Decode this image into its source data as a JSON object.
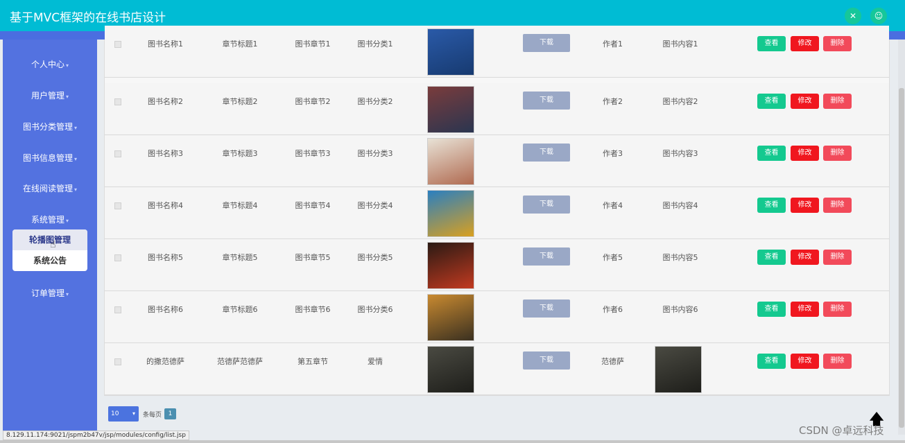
{
  "header": {
    "title": "基于MVC框架的在线书店设计",
    "icons": [
      "expand-icon",
      "user-icon"
    ]
  },
  "sidebar": {
    "items": [
      {
        "label": "个人中心"
      },
      {
        "label": "用户管理"
      },
      {
        "label": "图书分类管理"
      },
      {
        "label": "图书信息管理"
      },
      {
        "label": "在线阅读管理"
      },
      {
        "label": "系统管理"
      },
      {
        "label": "订单管理"
      }
    ],
    "submenu": [
      {
        "label": "轮播图管理"
      },
      {
        "label": "系统公告"
      }
    ]
  },
  "table": {
    "rows": [
      {
        "name": "图书名称1",
        "title": "章节标题1",
        "chapter": "图书章节1",
        "category": "图书分类1",
        "download": "下载",
        "author": "作者1",
        "content": "图书内容1",
        "view": "查看",
        "edit": "修改",
        "del": "删除",
        "cover": "#2a5aa8",
        "cover2": "#173a70"
      },
      {
        "name": "图书名称2",
        "title": "章节标题2",
        "chapter": "图书章节2",
        "category": "图书分类2",
        "download": "下载",
        "author": "作者2",
        "content": "图书内容2",
        "view": "查看",
        "edit": "修改",
        "del": "删除",
        "cover": "#7a3c3c",
        "cover2": "#2a3550"
      },
      {
        "name": "图书名称3",
        "title": "章节标题3",
        "chapter": "图书章节3",
        "category": "图书分类3",
        "download": "下载",
        "author": "作者3",
        "content": "图书内容3",
        "view": "查看",
        "edit": "修改",
        "del": "删除",
        "cover": "#e8e2d6",
        "cover2": "#b06a50"
      },
      {
        "name": "图书名称4",
        "title": "章节标题4",
        "chapter": "图书章节4",
        "category": "图书分类4",
        "download": "下载",
        "author": "作者4",
        "content": "图书内容4",
        "view": "查看",
        "edit": "修改",
        "del": "删除",
        "cover": "#2a7fc0",
        "cover2": "#d9a020"
      },
      {
        "name": "图书名称5",
        "title": "章节标题5",
        "chapter": "图书章节5",
        "category": "图书分类5",
        "download": "下载",
        "author": "作者5",
        "content": "图书内容5",
        "view": "查看",
        "edit": "修改",
        "del": "删除",
        "cover": "#2a1a14",
        "cover2": "#c23a20"
      },
      {
        "name": "图书名称6",
        "title": "章节标题6",
        "chapter": "图书章节6",
        "category": "图书分类6",
        "download": "下载",
        "author": "作者6",
        "content": "图书内容6",
        "view": "查看",
        "edit": "修改",
        "del": "删除",
        "cover": "#c98a30",
        "cover2": "#3a3020"
      },
      {
        "name": "的撒范德萨",
        "title": "范德萨范德萨",
        "chapter": "第五章节",
        "category": "爱情",
        "download": "下载",
        "author": "范德萨",
        "content": "",
        "view": "查看",
        "edit": "修改",
        "del": "删除",
        "cover": "#4a4a42",
        "cover2": "#1e1e1a"
      }
    ]
  },
  "pager": {
    "page_size": "10",
    "label": "条每页",
    "current": "1"
  },
  "status_url": "8.129.11.174:9021/jspm2b47v/jsp/modules/config/list.jsp",
  "watermark": "CSDN @卓远科技"
}
